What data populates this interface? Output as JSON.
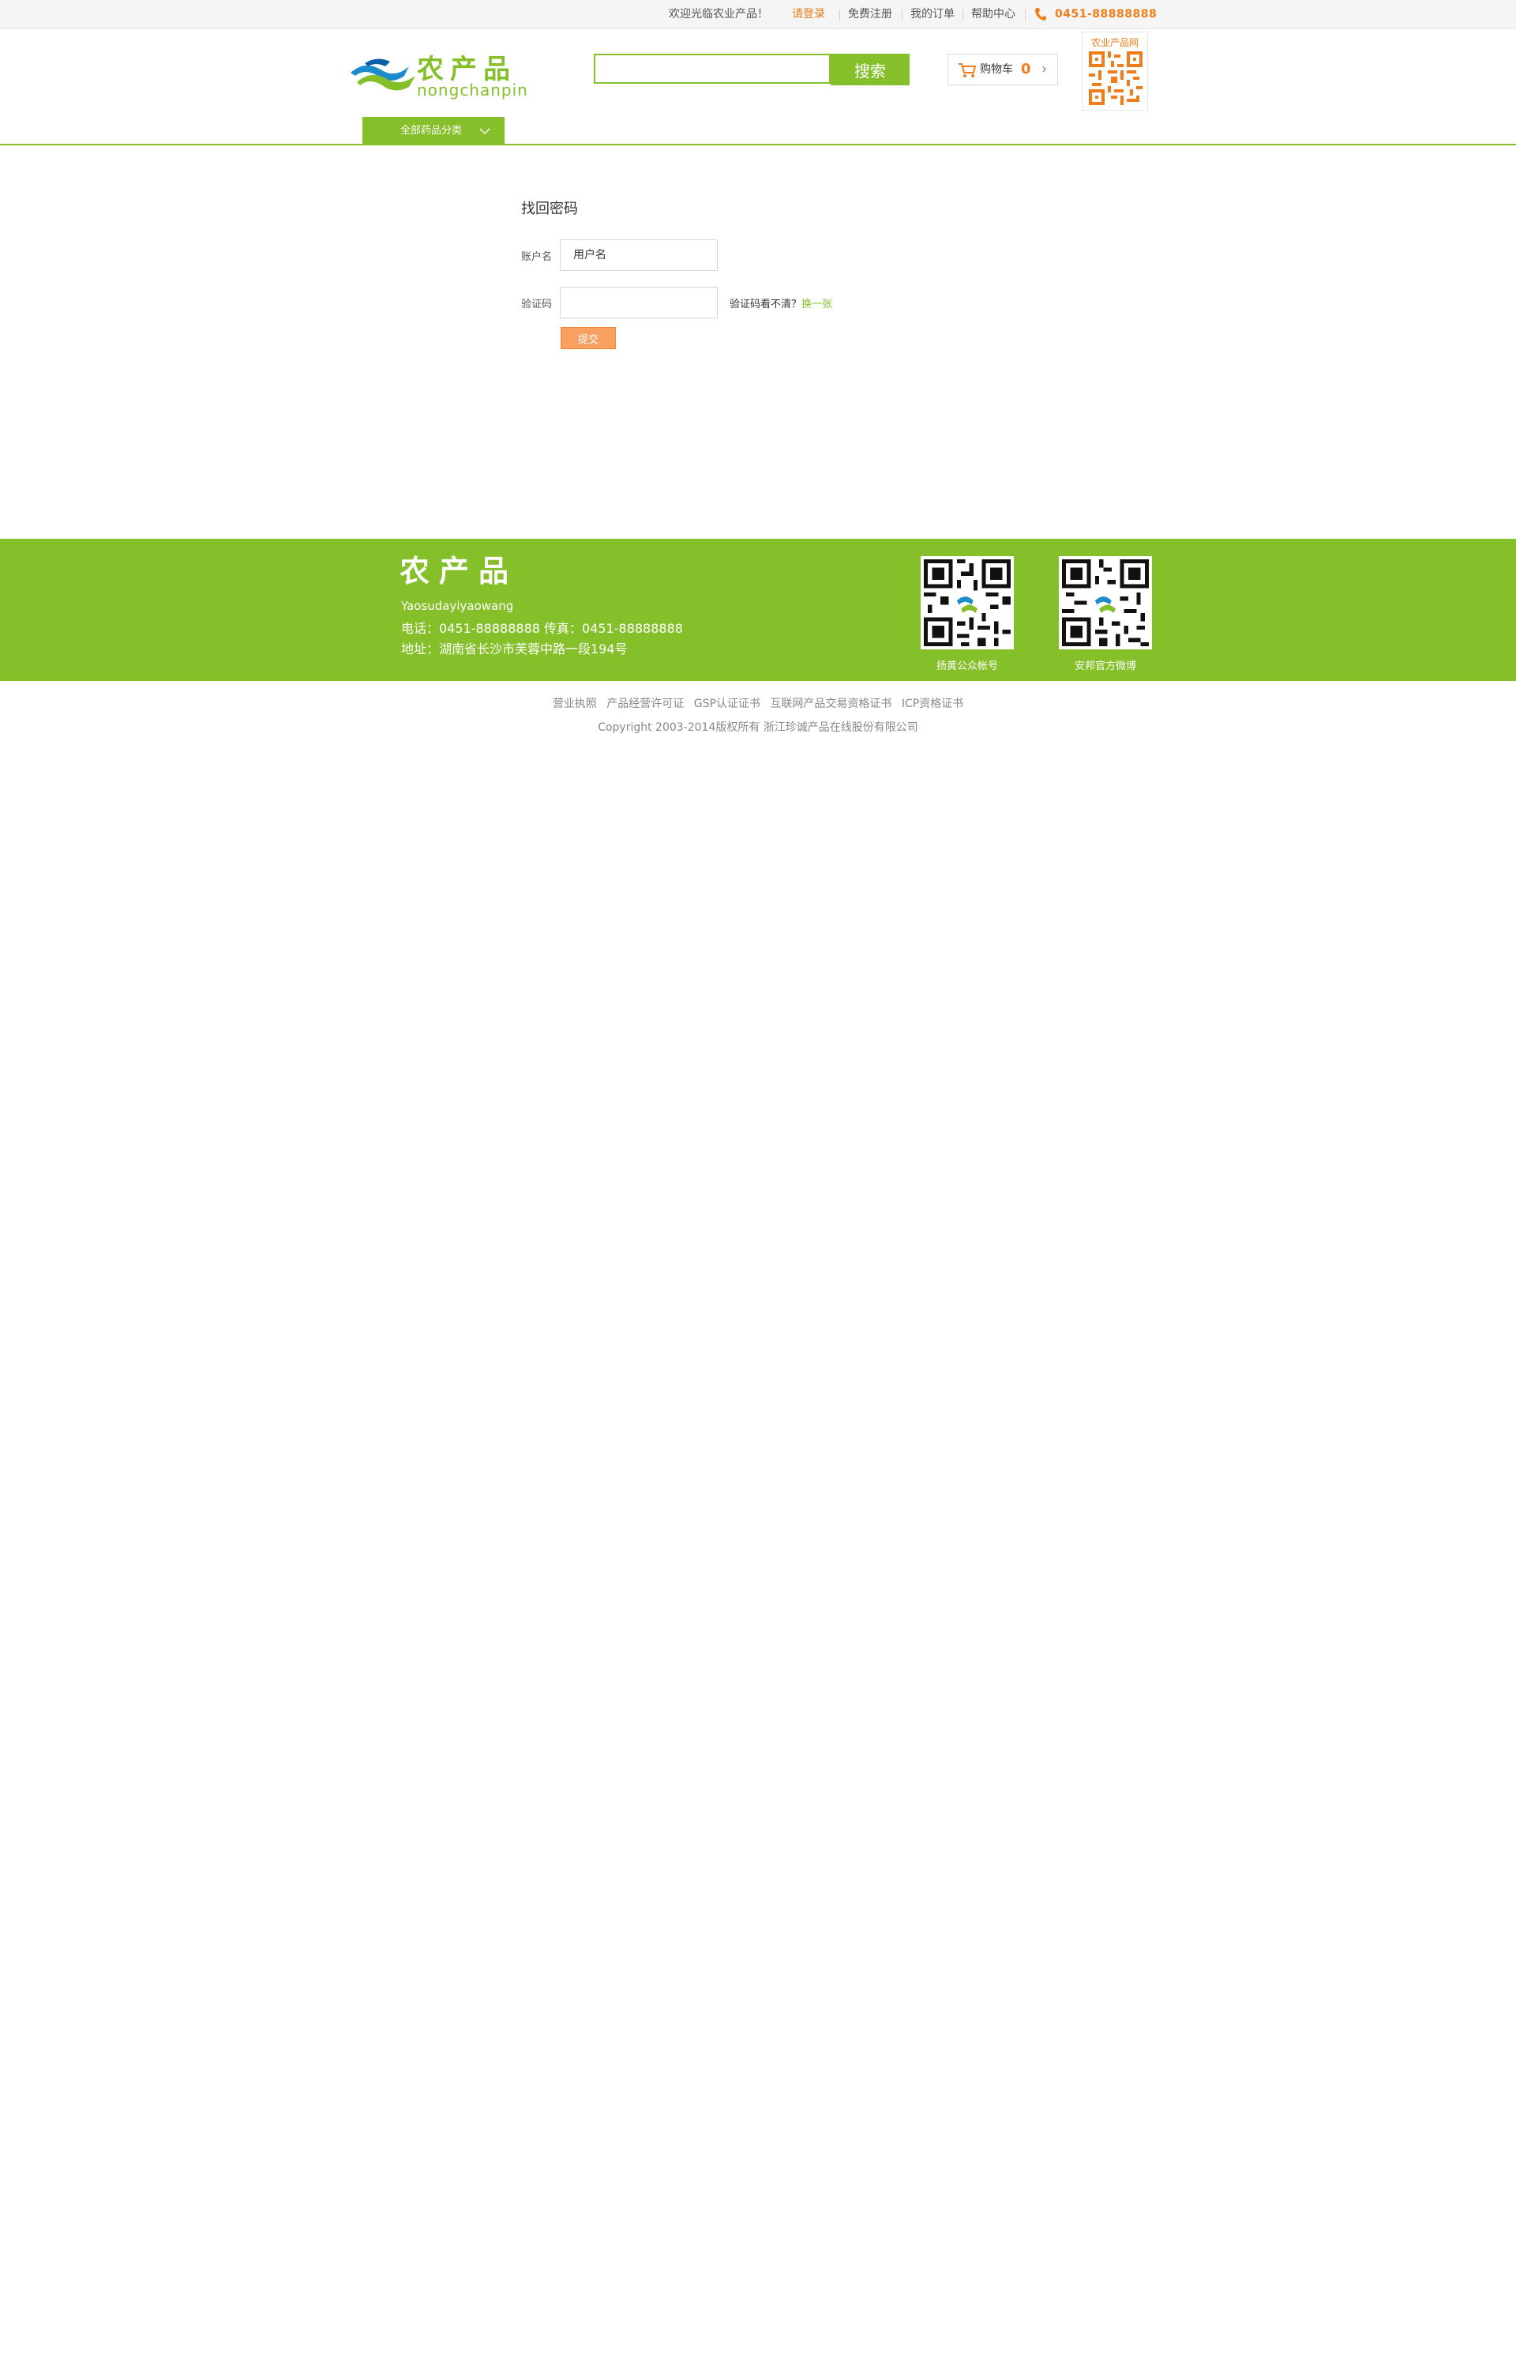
{
  "topbar": {
    "welcome": "欢迎光临农业产品！",
    "login": "请登录",
    "register": "免费注册",
    "orders": "我的订单",
    "help": "帮助中心",
    "phone": "0451-88888888"
  },
  "header": {
    "logo_cn": "农产品",
    "logo_en": "nongchanpin",
    "search_button": "搜索",
    "cart_label": "购物车",
    "cart_count": "0",
    "qr_caption": "农业产品网"
  },
  "nav": {
    "all_categories": "全部药品分类"
  },
  "form": {
    "title": "找回密码",
    "account_label": "账户名",
    "account_placeholder": "用户名",
    "captcha_label": "验证码",
    "captcha_hint": "验证码看不清？",
    "captcha_refresh": "换一张",
    "submit": "提交"
  },
  "footer": {
    "title": "农产品",
    "subtitle": "Yaosudayiyaowang",
    "contact": "电话：0451-88888888  传真：0451-88888888",
    "address": "地址：湖南省长沙市芙蓉中路一段194号",
    "qr1_caption": "扬黄公众帐号",
    "qr2_caption": "安邦官方微博",
    "links": [
      "营业执照",
      "产品经营许可证",
      "GSP认证证书",
      "互联网产品交易资格证书",
      "ICP资格证书"
    ],
    "copyright": "Copyright 2003-2014版权所有 浙江珍诚产品在线股份有限公司"
  },
  "colors": {
    "brand_green": "#85c02a",
    "accent_orange": "#f07d1a"
  }
}
